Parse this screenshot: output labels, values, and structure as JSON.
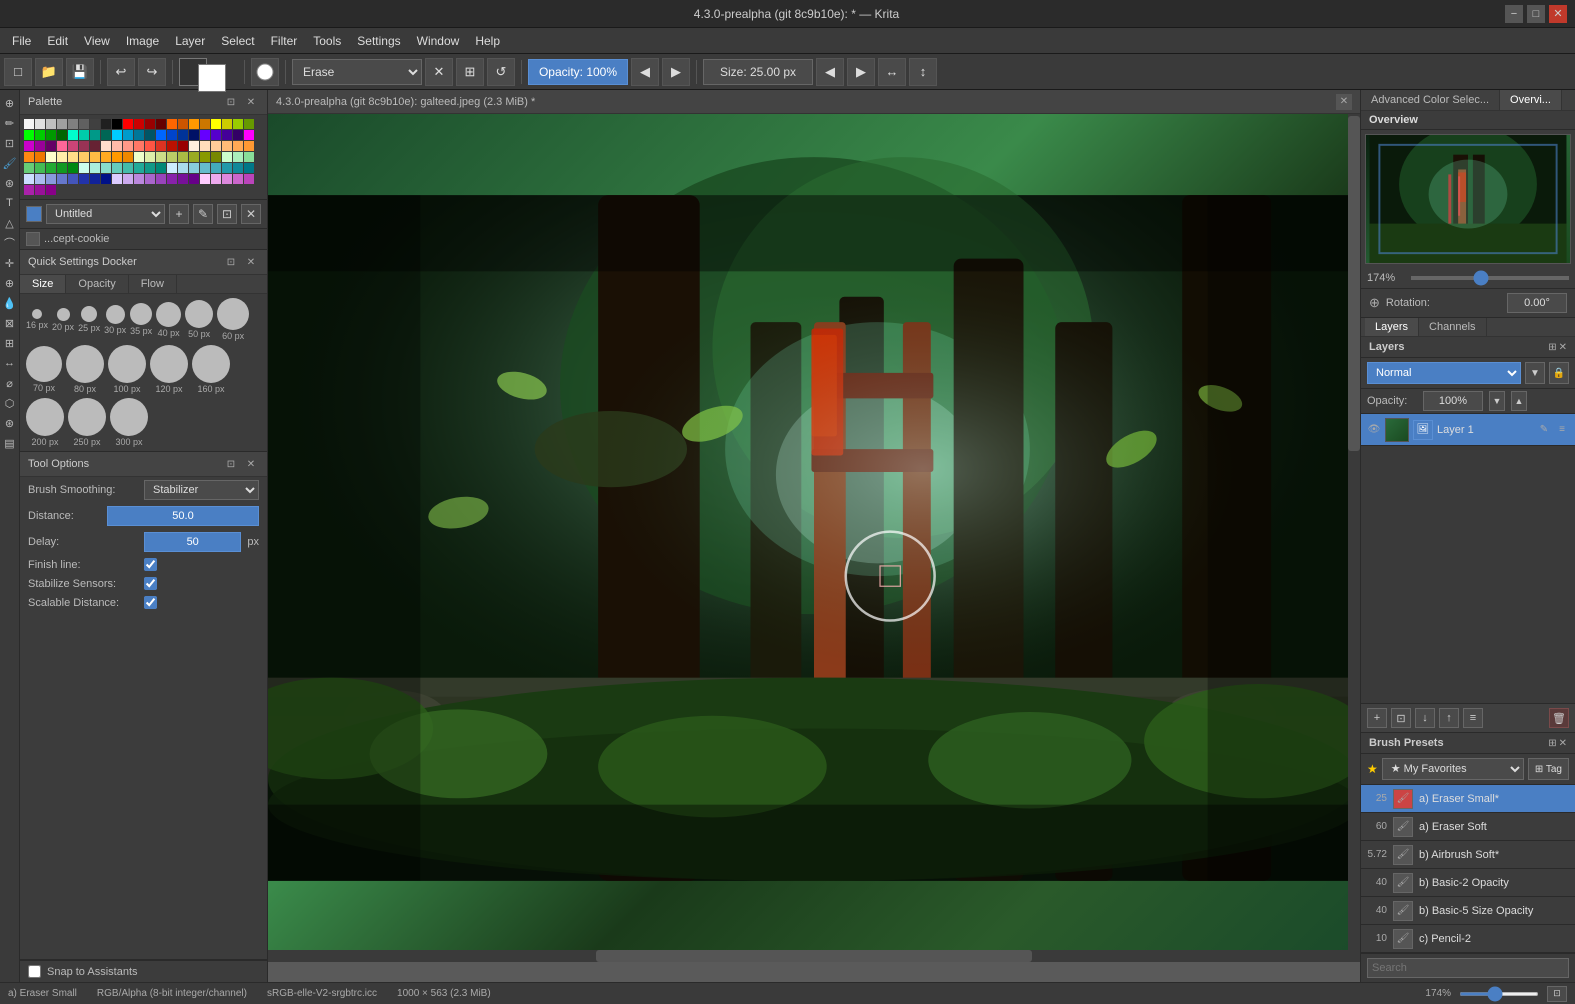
{
  "titlebar": {
    "title": "4.3.0-prealpha (git 8c9b10e): * — Krita",
    "minimize": "−",
    "maximize": "□",
    "close": "✕"
  },
  "menubar": {
    "items": [
      "File",
      "Edit",
      "View",
      "Image",
      "Layer",
      "Select",
      "Filter",
      "Tools",
      "Settings",
      "Window",
      "Help"
    ]
  },
  "toolbar": {
    "brush_mode": "Erase",
    "opacity_label": "Opacity: 100%",
    "size_label": "Size: 25.00 px"
  },
  "left_panel": {
    "palette": {
      "title": "Palette",
      "layer_name": "Untitled",
      "cookie_label": "...cept-cookie"
    },
    "quick_settings": {
      "title": "Quick Settings Docker",
      "tabs": [
        "Size",
        "Opacity",
        "Flow"
      ],
      "brush_sizes": [
        {
          "size": 16,
          "label": "16 px",
          "diameter": 10
        },
        {
          "size": 20,
          "label": "20 px",
          "diameter": 13
        },
        {
          "size": 25,
          "label": "25 px",
          "diameter": 16
        },
        {
          "size": 30,
          "label": "30 px",
          "diameter": 19
        },
        {
          "size": 35,
          "label": "35 px",
          "diameter": 22
        },
        {
          "size": 40,
          "label": "40 px",
          "diameter": 25
        },
        {
          "size": 50,
          "label": "50 px",
          "diameter": 28
        },
        {
          "size": 60,
          "label": "60 px",
          "diameter": 32
        },
        {
          "size": 70,
          "label": "70 px",
          "diameter": 36
        },
        {
          "size": 80,
          "label": "80 px",
          "diameter": 40
        },
        {
          "size": 100,
          "label": "100 px",
          "diameter": 46
        },
        {
          "size": 120,
          "label": "120 px",
          "diameter": 50
        },
        {
          "size": 160,
          "label": "160 px",
          "diameter": 58
        },
        {
          "size": 200,
          "label": "200 px",
          "diameter": 60
        },
        {
          "size": 250,
          "label": "250 px",
          "diameter": 60
        },
        {
          "size": 300,
          "label": "300 px",
          "diameter": 60
        }
      ]
    },
    "tool_options": {
      "title": "Tool Options",
      "brush_smoothing_label": "Brush Smoothing:",
      "brush_smoothing_value": "Stabilizer",
      "distance_label": "Distance:",
      "distance_value": "50.0",
      "delay_label": "Delay:",
      "delay_value": "50",
      "delay_unit": "px",
      "finish_line_label": "Finish line:",
      "finish_line_checked": true,
      "stabilize_sensors_label": "Stabilize Sensors:",
      "stabilize_sensors_checked": true,
      "scalable_distance_label": "Scalable Distance:",
      "scalable_distance_checked": true
    },
    "snap": {
      "label": "Snap to Assistants",
      "checked": false
    }
  },
  "canvas": {
    "tab_title": "4.3.0-prealpha (git 8c9b10e): galteed.jpeg (2.3 MiB) *",
    "status": {
      "color_mode": "RGB/Alpha (8-bit integer/channel)",
      "color_profile": "sRGB-elle-V2-srgbtrc.icc",
      "dimensions": "1000 × 563 (2.3 MiB)",
      "zoom": "174%",
      "brush_name": "a) Eraser Small"
    }
  },
  "right_panel": {
    "tabs": [
      "Advanced Color Selec...",
      "Overvi..."
    ],
    "overview": {
      "title": "Overview",
      "zoom_percent": "174%",
      "rotation_label": "Rotation:",
      "rotation_value": "0.00°"
    },
    "layers": {
      "tabs": [
        "Layers",
        "Channels"
      ],
      "header": "Layers",
      "blend_mode": "Normal",
      "opacity_label": "Opacity:",
      "opacity_value": "100%",
      "items": [
        {
          "name": "Layer 1",
          "visible": true,
          "selected": true
        }
      ],
      "toolbar_buttons": [
        "+",
        "□",
        "↓",
        "↑",
        "≡",
        "🗑"
      ]
    },
    "brush_presets": {
      "title": "Brush Presets",
      "favorites_label": "★ My Favorites",
      "tag_label": "⊞ Tag",
      "items": [
        {
          "size": "25",
          "name": "a) Eraser Small*",
          "selected": true,
          "color": "#c44"
        },
        {
          "size": "60",
          "name": "a) Eraser Soft",
          "selected": false,
          "color": "#555"
        },
        {
          "size": "5.72",
          "name": "b) Airbrush Soft*",
          "selected": false,
          "color": "#555"
        },
        {
          "size": "40",
          "name": "b) Basic-2 Opacity",
          "selected": false,
          "color": "#555"
        },
        {
          "size": "40",
          "name": "b) Basic-5 Size Opacity",
          "selected": false,
          "color": "#555"
        },
        {
          "size": "10",
          "name": "c) Pencil-2",
          "selected": false,
          "color": "#555"
        }
      ],
      "search_placeholder": "Search"
    }
  },
  "colors": {
    "accent_blue": "#4a7fc4",
    "panel_bg": "#3c3c3c",
    "header_bg": "#444444",
    "selected_bg": "#4a7fc4",
    "border": "#2a2a2a"
  },
  "palette_colors": [
    "#f5f5f5",
    "#e0e0e0",
    "#c0c0c0",
    "#a0a0a0",
    "#808080",
    "#606060",
    "#404040",
    "#202020",
    "#000000",
    "#ff0000",
    "#cc0000",
    "#990000",
    "#660000",
    "#ff6600",
    "#cc5500",
    "#ff9900",
    "#cc7700",
    "#ffff00",
    "#cccc00",
    "#99cc00",
    "#669900",
    "#00ff00",
    "#00cc00",
    "#009900",
    "#006600",
    "#00ffcc",
    "#00ccaa",
    "#009988",
    "#006655",
    "#00ccff",
    "#009bcc",
    "#007799",
    "#005566",
    "#0066ff",
    "#0044cc",
    "#003399",
    "#001166",
    "#6600ff",
    "#5500cc",
    "#440099",
    "#330066",
    "#ff00ff",
    "#cc00cc",
    "#990099",
    "#660066",
    "#ff6699",
    "#cc4477",
    "#993355",
    "#662233",
    "#ffddcc",
    "#ffbbaa",
    "#ff9988",
    "#ff7766",
    "#ff5544",
    "#dd3322",
    "#bb1100",
    "#990000",
    "#ffeedd",
    "#ffddbb",
    "#ffcc99",
    "#ffbb77",
    "#ffaa55",
    "#ff9933",
    "#ff8811",
    "#ee7700",
    "#ffffcc",
    "#ffeeaa",
    "#ffdd88",
    "#ffcc66",
    "#ffbb44",
    "#ffaa22",
    "#ff9900",
    "#ee8800",
    "#eeffcc",
    "#ddeeaa",
    "#ccdd88",
    "#bbcc66",
    "#aabb44",
    "#99aa22",
    "#889900",
    "#778800",
    "#ccffcc",
    "#aaeebb",
    "#88dd99",
    "#66cc77",
    "#44bb55",
    "#22aa33",
    "#119922",
    "#008811",
    "#ccffee",
    "#aaeedd",
    "#88ddcc",
    "#66ccbb",
    "#44bbaa",
    "#22aa99",
    "#119988",
    "#008877",
    "#cceeff",
    "#aaddee",
    "#88ccdd",
    "#66bbcc",
    "#44aabb",
    "#2299aa",
    "#118899",
    "#007788",
    "#ccddff",
    "#aabbee",
    "#8899dd",
    "#6677cc",
    "#4455bb",
    "#2233aa",
    "#112299",
    "#001188",
    "#ddccff",
    "#ccaaee",
    "#bb88dd",
    "#aa66cc",
    "#9944bb",
    "#8822aa",
    "#771199",
    "#660088",
    "#ffccff",
    "#eeaaee",
    "#dd88dd",
    "#cc66cc",
    "#bb44bb",
    "#aa22aa",
    "#991199",
    "#880088"
  ]
}
